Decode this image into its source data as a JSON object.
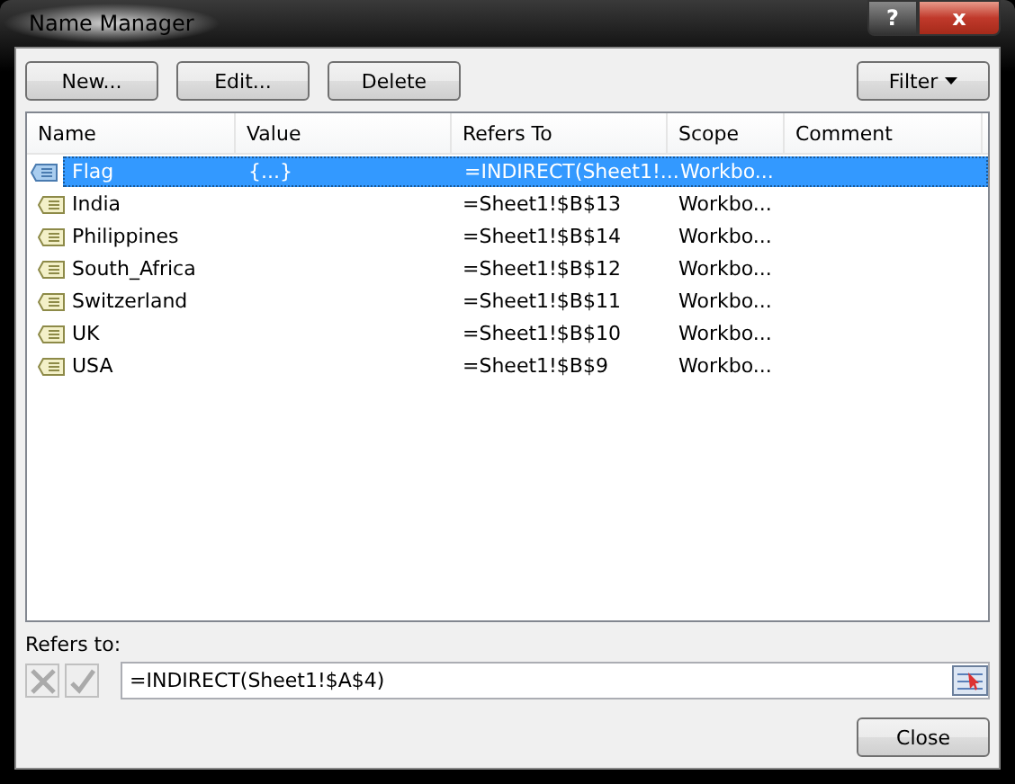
{
  "window": {
    "title": "Name Manager",
    "help_button": "?",
    "close_button": "x"
  },
  "toolbar": {
    "buttons": [
      "New...",
      "Edit...",
      "Delete"
    ],
    "filter_button": "Filter"
  },
  "table": {
    "columns": [
      "Name",
      "Value",
      "Refers To",
      "Scope",
      "Comment"
    ],
    "rows": [
      {
        "name": "Flag",
        "value": "{...}",
        "refers_to": "=INDIRECT(Sheet1!...",
        "scope": "Workbo...",
        "selected": true
      },
      {
        "name": "India",
        "refers_to": "=Sheet1!$B$13",
        "scope": "Workbo...",
        "selected": false
      },
      {
        "name": "Philippines",
        "refers_to": "=Sheet1!$B$14",
        "scope": "Workbo...",
        "selected": false
      },
      {
        "name": "South_Africa",
        "refers_to": "=Sheet1!$B$12",
        "scope": "Workbo...",
        "selected": false
      },
      {
        "name": "Switzerland",
        "refers_to": "=Sheet1!$B$11",
        "scope": "Workbo...",
        "selected": false
      },
      {
        "name": "UK",
        "refers_to": "=Sheet1!$B$10",
        "scope": "Workbo...",
        "selected": false
      },
      {
        "name": "USA",
        "refers_to": "=Sheet1!$B$9",
        "scope": "Workbo...",
        "selected": false
      }
    ]
  },
  "refers_to": {
    "label": "Refers to:",
    "value": "=INDIRECT(Sheet1!$A$4)",
    "cancel_disabled": true,
    "confirm_disabled": true
  },
  "close_button": "Close"
}
